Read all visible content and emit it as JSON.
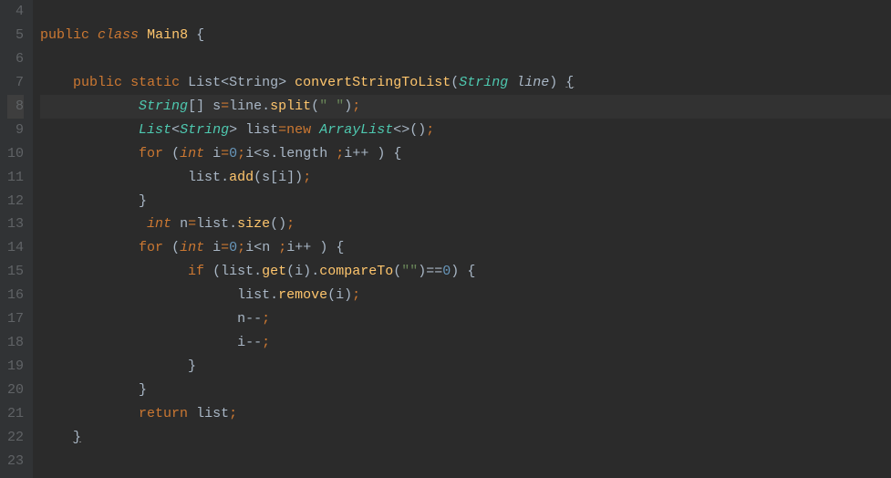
{
  "lineNumbers": [
    "4",
    "5",
    "6",
    "7",
    "8",
    "9",
    "10",
    "11",
    "12",
    "13",
    "14",
    "15",
    "16",
    "17",
    "18",
    "19",
    "20",
    "21",
    "22",
    "23"
  ],
  "highlightedLine": "8",
  "code": {
    "l4": "",
    "l5": {
      "public": "public",
      "class": "class",
      "name": "Main8",
      "brace": "{"
    },
    "l6": "",
    "l7": {
      "public": "public",
      "static": "static",
      "rettype": "List",
      "generic": "String",
      "method": "convertStringToList",
      "paramtype": "String",
      "paramname": "line",
      "brace": "{"
    },
    "l8": {
      "type": "String",
      "var": "s",
      "eq": "=",
      "obj": "line",
      "method": "split",
      "arg": "\" \""
    },
    "l9": {
      "type": "List",
      "generic": "String",
      "var": "list",
      "eq": "=",
      "new": "new",
      "ctor": "ArrayList"
    },
    "l10": {
      "for": "for",
      "int": "int",
      "var": "i",
      "eq": "=",
      "zero": "0",
      "cond_i": "i",
      "lt": "<",
      "s": "s",
      "length": "length",
      "inc_i": "i",
      "inc": "++"
    },
    "l11": {
      "obj": "list",
      "method": "add",
      "s": "s",
      "i": "i"
    },
    "l12": {
      "brace": "}"
    },
    "l13": {
      "int": "int",
      "var": "n",
      "eq": "=",
      "obj": "list",
      "method": "size"
    },
    "l14": {
      "for": "for",
      "int": "int",
      "var": "i",
      "eq": "=",
      "zero": "0",
      "cond_i": "i",
      "lt": "<",
      "n": "n",
      "inc_i": "i",
      "inc": "++"
    },
    "l15": {
      "if": "if",
      "obj": "list",
      "get": "get",
      "i": "i",
      "compareTo": "compareTo",
      "empty": "\"\"",
      "eqeq": "==",
      "zero": "0"
    },
    "l16": {
      "obj": "list",
      "method": "remove",
      "i": "i"
    },
    "l17": {
      "var": "n",
      "op": "--"
    },
    "l18": {
      "var": "i",
      "op": "--"
    },
    "l19": {
      "brace": "}"
    },
    "l20": {
      "brace": "}"
    },
    "l21": {
      "return": "return",
      "var": "list"
    },
    "l22": {
      "brace": "}"
    },
    "l23": ""
  }
}
